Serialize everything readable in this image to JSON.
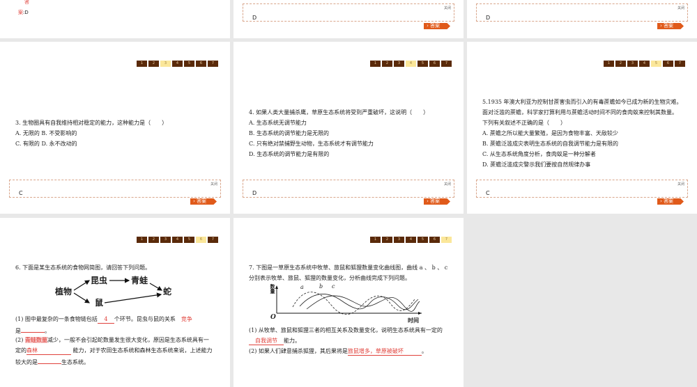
{
  "nav_pages": [
    "1",
    "2",
    "3",
    "4",
    "5",
    "6",
    "7"
  ],
  "close_label": "关闭",
  "answer_btn": "答案",
  "top": {
    "ans_label_1": "答",
    "ans_label_2": "案",
    "ans_value": ":D",
    "box1": "D",
    "box2": "D"
  },
  "q3": {
    "stem": "3. 生物圈具有自我维持相对稳定的能力，这种能力是（　　）",
    "l1": "A. 无限的 B. 不受影响的",
    "l2": "C. 有限的 D. 永不改动的",
    "answer": "C",
    "current": 3
  },
  "q4": {
    "stem": "4. 如果人类大量捕杀鹰，草原生态系统将受到严重破坏，这说明（　　）",
    "opts": [
      "A. 生态系统无调节能力",
      "B. 生态系统的调节能力是无限的",
      "C. 只有绝对禁捕野生动物，生态系统才有调节能力",
      "D. 生态系统的调节能力是有限的"
    ],
    "answer": "D",
    "current": 4
  },
  "q5": {
    "stem": [
      "5.1935 年澳大利亚为控制甘蔗害虫而引入的有毒蔗蟾如今已成为新的生物灾难。",
      "面对泛滥的蔗蟾，科学家打算利用与蔗蟾活动时间不同的食肉蚁来控制其数量。",
      "下列有关叙述不正确的是（　　）"
    ],
    "opts": [
      "A. 蔗蟾之所以能大量繁殖，是因为食物丰富、天敌较少",
      "B. 蔗蟾泛滥成灾表明生态系统的自我调节能力是有限的",
      "C. 从生态系统角度分析，食肉蚁是一种分解者",
      "D. 蔗蟾泛滥成灾警示我们要按自然规律办事"
    ],
    "answer": "C",
    "current": 5
  },
  "q6": {
    "stem": "6. 下面是某生态系统的食物网简图，请回答下列问题。",
    "web": {
      "plant": "植物",
      "insect": "昆虫",
      "frog": "青蛙",
      "snake": "蛇",
      "mouse": "鼠"
    },
    "p1a": "(1) 图中最复杂的一条食物链包括",
    "p1_ans": "4",
    "p1b": "个环节。昆虫与鼠的关系",
    "p1_ans2": "竞争",
    "p1c": "是",
    "p2a": "(2) ",
    "p2_ans": "青蛙数量",
    "p2b": "减少，一般不会引起蛇数量发生很大变化，原因是生态系统具有一",
    "p3a": "定的",
    "p3_ans": "森林",
    "p3b": " 能力，对于农田生态系统和森林生态系统来说，上述能力",
    "p4a": "较大的是",
    "p4b": "生态系统。",
    "current": 6
  },
  "q7": {
    "stem1": "7. 下图是一草原生态系统中牧草、旅鼠和狐狸数量变化曲线图，曲线 a 、 b 、 c",
    "stem2": "分别表示牧草、旅鼠、狐狸的数量变化，分析曲线完成下列问题。",
    "chart": {
      "ylabel": "数量",
      "xlabel": "时间",
      "origin": "O",
      "a": "a",
      "b": "b",
      "c": "c"
    },
    "p1a": "(1) 从牧草、旅鼠和狐狸三者的相互关系及数量变化，说明生态系统具有一定的",
    "p1_ans": "自我调节",
    "p1b": "能力。",
    "p2a": "(2) 如果人们肆意捕杀狐狸，其后果将是",
    "p2_ans": "旅鼠增多，草原被破坏",
    "p2b": "。",
    "current": 7
  }
}
